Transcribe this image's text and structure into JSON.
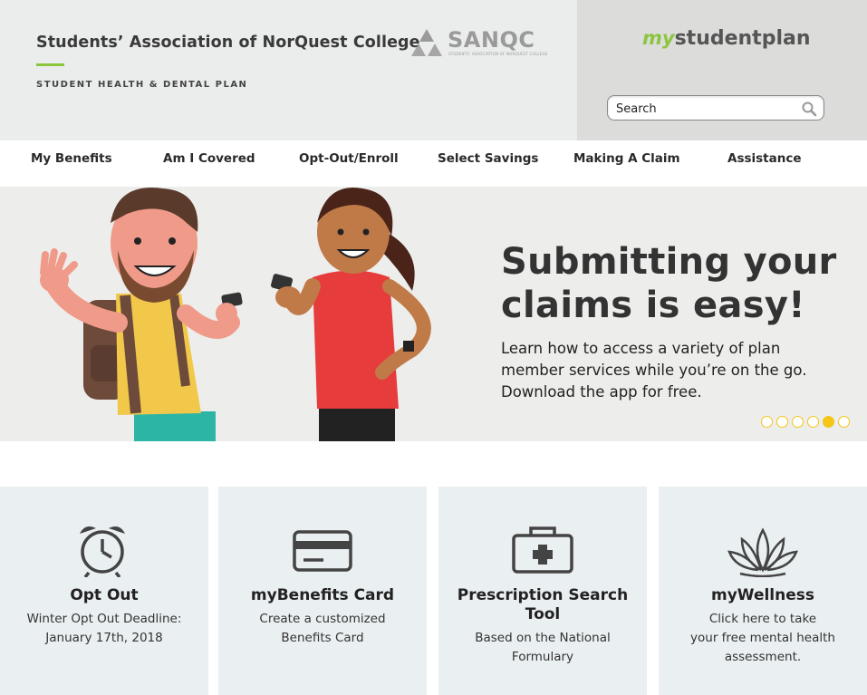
{
  "header": {
    "org_title": "Students’ Association of NorQuest College",
    "org_subtitle": "STUDENT HEALTH & DENTAL PLAN",
    "sanqc_logo_text": "SANQC",
    "sanqc_logo_small": "STUDENTS' ASSOCIATION OF NORQUEST COLLEGE",
    "msp_logo_my": "my",
    "msp_logo_rest": "studentplan",
    "search_placeholder": "Search",
    "accent_color": "#8cc63f"
  },
  "nav": {
    "items": [
      {
        "label": "My Benefits"
      },
      {
        "label": "Am I Covered"
      },
      {
        "label": "Opt-Out/Enroll"
      },
      {
        "label": "Select Savings"
      },
      {
        "label": "Making A Claim"
      },
      {
        "label": "Assistance"
      }
    ]
  },
  "hero": {
    "headline_line1": "Submitting your",
    "headline_line2": "claims is easy!",
    "body_line1": "Learn how to access a variety of plan",
    "body_line2": "member services while you’re on the go.",
    "body_line3": "Download the app for free.",
    "slide_count": 6,
    "active_slide": 5,
    "dot_color": "#f5c518"
  },
  "cards": [
    {
      "icon": "alarm-clock-icon",
      "title": "Opt Out",
      "desc_line1": "Winter Opt Out Deadline:",
      "desc_line2": "January 17th, 2018",
      "desc_line3": ""
    },
    {
      "icon": "credit-card-icon",
      "title": "myBenefits Card",
      "desc_line1": "Create a customized",
      "desc_line2": "Benefits Card",
      "desc_line3": ""
    },
    {
      "icon": "first-aid-kit-icon",
      "title_line1": "Prescription Search",
      "title_line2": "Tool",
      "desc_line1": "Based on the National",
      "desc_line2": "Formulary",
      "desc_line3": ""
    },
    {
      "icon": "lotus-icon",
      "title": "myWellness",
      "desc_line1": "Click here to take",
      "desc_line2": "your free mental health",
      "desc_line3": "assessment."
    }
  ]
}
